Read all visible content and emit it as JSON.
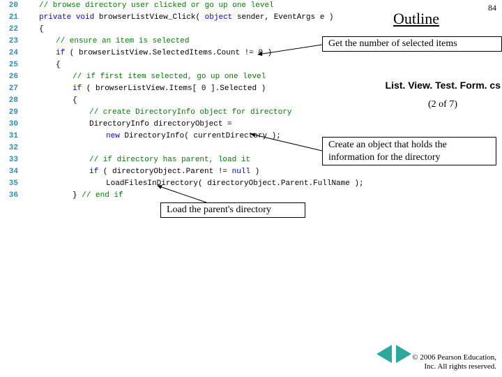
{
  "slide": {
    "number": "84",
    "outline_label": "Outline",
    "filename": "List. View. Test. Form. cs",
    "page_of": "(2 of 7)"
  },
  "callouts": {
    "selected_items": "Get the number of selected items",
    "directory_object": "Create an object that holds  the information for the directory",
    "load_parent": "Load the parent's directory"
  },
  "nav": {
    "copyright_line1": "© 2006 Pearson Education,",
    "copyright_line2": "Inc.  All rights reserved."
  },
  "code": {
    "l20": "// browse directory user clicked or go up one level",
    "l21_kw1": "private",
    "l21_kw2": "void",
    "l21_name": " browserListView_Click( ",
    "l21_kw3": "object",
    "l21_rest": " sender, EventArgs e )",
    "l22": "{",
    "l23": "// ensure an item is selected",
    "l24_kw": "if",
    "l24_rest": " ( browserListView.SelectedItems.Count != ",
    "l24_num": "0",
    "l24_end": " )",
    "l25": "{",
    "l26": "// if first item selected, go up one level",
    "l27_kw": "if",
    "l27_rest": " ( browserListView.Items[ ",
    "l27_num": "0",
    "l27_end": " ].Selected )",
    "l28": "{",
    "l29": "// create DirectoryInfo object for directory",
    "l30_a": "DirectoryInfo directoryObject =",
    "l31_kw": "new",
    "l31_rest": " DirectoryInfo( currentDirectory );",
    "l32": "",
    "l33": "// if directory has parent, load it",
    "l34_kw": "if",
    "l34_rest": " ( directoryObject.Parent != ",
    "l34_null": "null",
    "l34_end": " )",
    "l35": "LoadFilesInDirectory( directoryObject.Parent.FullName );",
    "l36_a": "} ",
    "l36_b": "// end if"
  }
}
